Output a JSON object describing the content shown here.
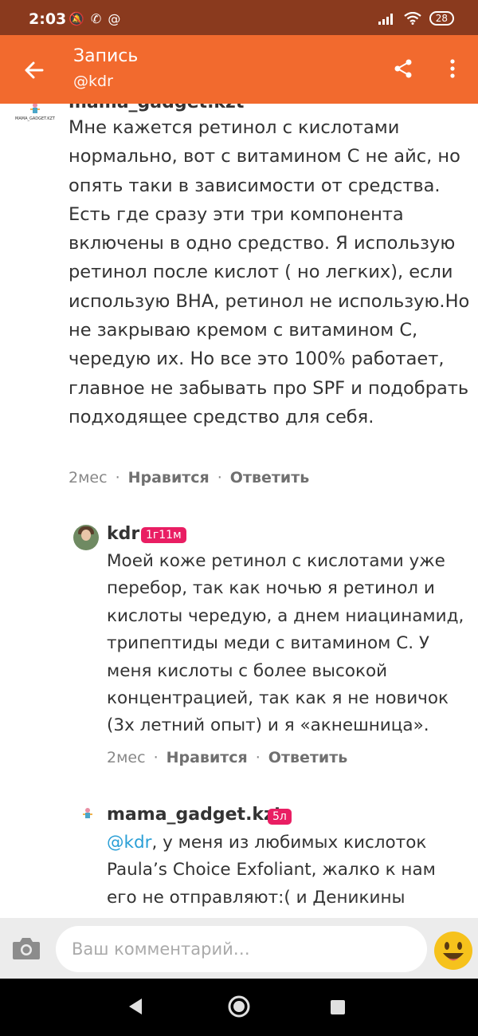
{
  "status_bar": {
    "time": "2:03",
    "battery": "28",
    "left_icons": [
      "mute-icon",
      "whatsapp-icon",
      "at-icon"
    ],
    "right_icons": [
      "signal-icon",
      "wifi-icon",
      "battery-icon"
    ]
  },
  "app_bar": {
    "title": "Запись",
    "subtitle": "@kdr",
    "color": "#f26a2e"
  },
  "comments": [
    {
      "author": "mama_gadget.kzt",
      "avatar_caption": "MAMA_GADGET.KZT",
      "text": "Мне кажется ретинол с кислотами нормально, вот с витамином С не айс, но опять таки в зависимости от средства. Есть где сразу эти три компонента включены в одно средство. Я использую ретинол после кислот ( но легких), если использую BHA, ретинол не использую.Но не закрываю кремом с витамином С, чередую их. Но все это 100% работает, главное не забывать про SPF и подобрать подходящее средство для себя.",
      "time": "2мес",
      "like_label": "Нравится",
      "reply_label": "Ответить"
    },
    {
      "author": "kdr",
      "badge": "1г11м",
      "text": "Моей коже ретинол с кислотами уже перебор, так как ночью я ретинол и кислоты чередую, а днем ниацинамид, трипептиды меди с витамином С. У меня кислоты с более высокой концентрацией, так как я не новичок (3х летний опыт) и я «акнешница».",
      "time": "2мес",
      "like_label": "Нравится",
      "reply_label": "Ответить"
    },
    {
      "author": "mama_gadget.kzt",
      "badge": "5л",
      "mention": "@kdr",
      "text": ", у меня из любимых кислоток Paula’s Choice Exfoliant, жалко к нам его не отправляют:( и Деникины"
    }
  ],
  "comment_input": {
    "placeholder": "Ваш комментарий…"
  },
  "badge_color": "#e91e63"
}
